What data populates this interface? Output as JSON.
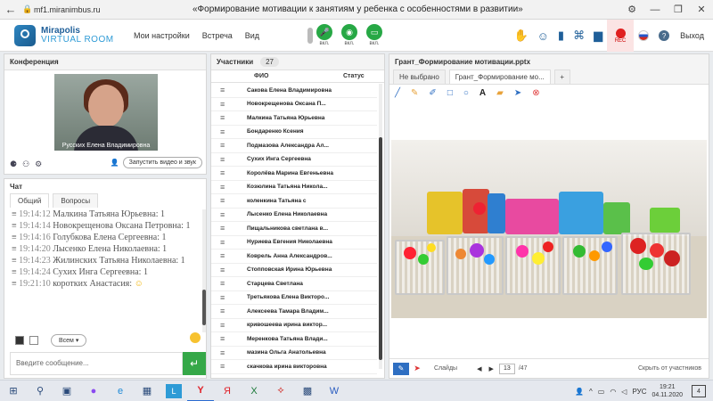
{
  "browser": {
    "url": "mf1.miranimbus.ru",
    "title": "«Формирование мотивации к занятиям у ребенка с особенностями в развитии»"
  },
  "header": {
    "logo_line1": "Mirapolis",
    "logo_line2": "VIRTUAL ROOM",
    "menu": [
      "Мои настройки",
      "Встреча",
      "Вид"
    ],
    "media_labels": [
      "вкл.",
      "вкл.",
      "вкл."
    ],
    "rec_label": "REC",
    "exit_label": "Выход"
  },
  "conference": {
    "title": "Конференция",
    "video_name": "Русских Елена Владимировна",
    "start_video_label": "Запустить видео и звук"
  },
  "chat": {
    "title": "Чат",
    "tabs": [
      "Общий",
      "Вопросы"
    ],
    "messages": [
      {
        "time": "19:14:12",
        "text": "Малкина  Татьяна  Юрьевна: 1"
      },
      {
        "time": "19:14:14",
        "text": "Новокрещенова  Оксана  Петровна: 1"
      },
      {
        "time": "19:14:16",
        "text": "Голубкова  Елена  Сергеевна: 1"
      },
      {
        "time": "19:14:20",
        "text": "Лысенко Елена  Николаевна: 1"
      },
      {
        "time": "19:14:23",
        "text": "Жилинских  Татьяна  Николаевна: 1"
      },
      {
        "time": "19:14:24",
        "text": "Сухих  Инга Сергеевна: 1"
      },
      {
        "time": "19:21:10",
        "text": "коротких Анастасия:"
      }
    ],
    "recipient": "Всем",
    "input_placeholder": "Введите сообщение..."
  },
  "participants": {
    "title": "Участники",
    "count": "27",
    "col_name": "ФИО",
    "col_status": "Статус",
    "rows": [
      "Сакова Елена Владимировна",
      "Новокрещенова  Оксана  П...",
      "Малкина Татьяна  Юрьевна",
      "Бондаренко  Ксения",
      "Подмазова Александра  Ал...",
      "Сухих  Инга Сергеевна",
      "Королёва Марина Евгеньевна",
      "Козюлина  Татьяна Никола...",
      "коленкина Татьяна  с",
      "Лысенко Елена  Николаевна",
      "Пищальникова  светлана в...",
      "Нуриева Евгения Николаевна",
      "Коврель Анна  Александров...",
      "Стопповская Ирина Юрьевна",
      "Старцева Светлана",
      "Третьякова  Елена Викторо...",
      "Алексеева  Тамара  Владим...",
      "кривошеева  ирина виктор...",
      "Меренкова  Татьяна  Влади...",
      "мазина  Ольга Анатольевна",
      "скачкова ирина викторовна"
    ]
  },
  "grant": {
    "title": "Грант_Формирование мотивации.pptx",
    "tabs": [
      "Не выбрано",
      "Грант_Формирование мо...",
      "+"
    ],
    "slides_label": "Слайды",
    "page": "13",
    "total": "/47",
    "hide_label": "Скрыть от участников"
  },
  "taskbar": {
    "lang": "РУС",
    "time": "19:21",
    "date": "04.11.2020",
    "notif": "4"
  }
}
